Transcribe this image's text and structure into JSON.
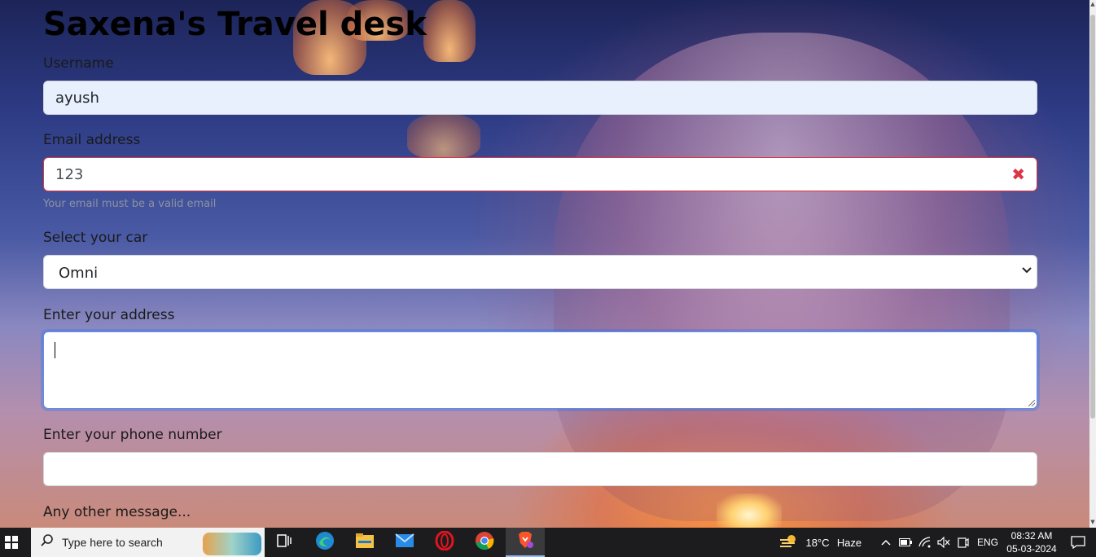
{
  "page": {
    "title": "Saxena's Travel desk"
  },
  "form": {
    "username_label": "Username",
    "username_value": "ayush",
    "email_label": "Email address",
    "email_value": "123",
    "email_error_icon": "✖",
    "email_help": "Your email must be a valid email",
    "car_label": "Select your car",
    "car_selected": "Omni",
    "address_label": "Enter your address",
    "address_value": "",
    "phone_label": "Enter your phone number",
    "phone_value": "",
    "message_label": "Any other message..."
  },
  "taskbar": {
    "search_placeholder": "Type here to search",
    "apps": [
      {
        "name": "task-view-icon"
      },
      {
        "name": "edge-icon"
      },
      {
        "name": "file-explorer-icon"
      },
      {
        "name": "mail-icon"
      },
      {
        "name": "opera-icon"
      },
      {
        "name": "chrome-icon"
      },
      {
        "name": "brave-icon"
      }
    ],
    "weather_temp": "18°C",
    "weather_text": "Haze",
    "language": "ENG",
    "time": "08:32 AM",
    "date": "05-03-2024"
  }
}
